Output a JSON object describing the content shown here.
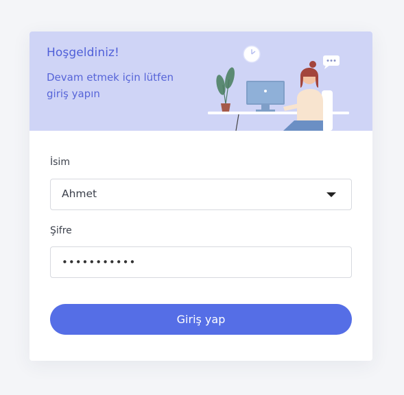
{
  "banner": {
    "title": "Hoşgeldiniz!",
    "subtitle": "Devam etmek için lütfen giriş yapın",
    "illustration": "woman-at-desk-illustration"
  },
  "form": {
    "name_label": "İsim",
    "name_value": "Ahmet",
    "password_label": "Şifre",
    "password_value": "•••••••••••",
    "submit_label": "Giriş yap"
  },
  "colors": {
    "accent": "#556ee6",
    "banner_bg": "#cfd4f6",
    "title_text": "#4f5fd8",
    "page_bg": "#f4f5f8"
  }
}
